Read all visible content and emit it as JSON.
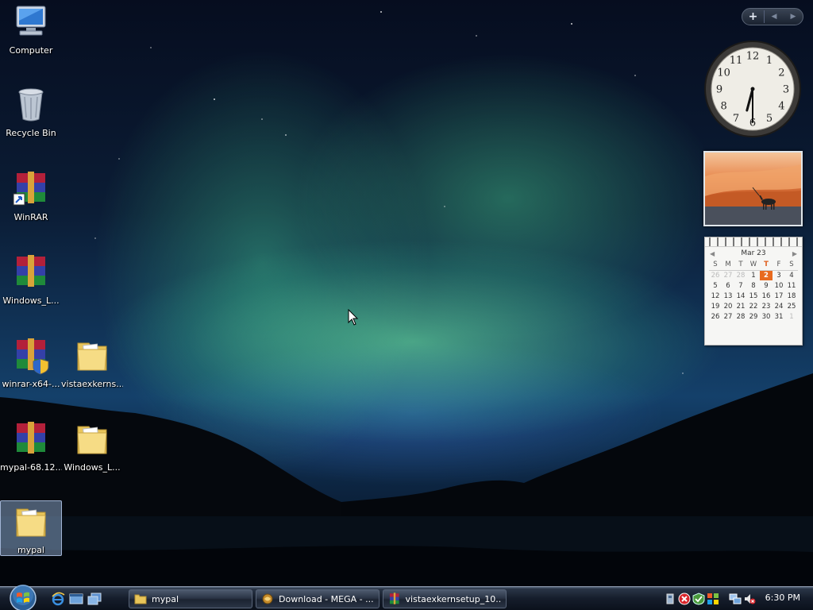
{
  "desktop": {
    "icons": [
      {
        "label": "Computer"
      },
      {
        "label": "Recycle Bin"
      },
      {
        "label": "WinRAR"
      },
      {
        "label": "Windows_L..."
      },
      {
        "label": "winrar-x64-..."
      },
      {
        "label": "vistaexkerns..."
      },
      {
        "label": "mypal-68.12..."
      },
      {
        "label": "Windows_L..."
      },
      {
        "label": "mypal"
      }
    ]
  },
  "sidebar": {
    "add_label": "+",
    "clock": {
      "hour": 6,
      "minute": 30,
      "numbers": [
        "12",
        "1",
        "2",
        "3",
        "4",
        "5",
        "6",
        "7",
        "8",
        "9",
        "10",
        "11"
      ]
    },
    "calendar": {
      "month_label": "Mar 23",
      "weekdays": [
        "S",
        "M",
        "T",
        "W",
        "T",
        "F",
        "S"
      ],
      "today_col": 4,
      "weeks": [
        [
          "26",
          "27",
          "28",
          "1",
          "2",
          "3",
          "4"
        ],
        [
          "5",
          "6",
          "7",
          "8",
          "9",
          "10",
          "11"
        ],
        [
          "12",
          "13",
          "14",
          "15",
          "16",
          "17",
          "18"
        ],
        [
          "19",
          "20",
          "21",
          "22",
          "23",
          "24",
          "25"
        ],
        [
          "26",
          "27",
          "28",
          "29",
          "30",
          "31",
          "1"
        ]
      ],
      "today": "2"
    }
  },
  "taskbar": {
    "buttons": [
      {
        "label": "mypal"
      },
      {
        "label": "Download - MEGA - ..."
      },
      {
        "label": "vistaexkernsetup_10..."
      }
    ],
    "time": "6:30 PM"
  },
  "colors": {
    "calendar_today": "#e86a1e",
    "taskbar": "#151d2b"
  }
}
